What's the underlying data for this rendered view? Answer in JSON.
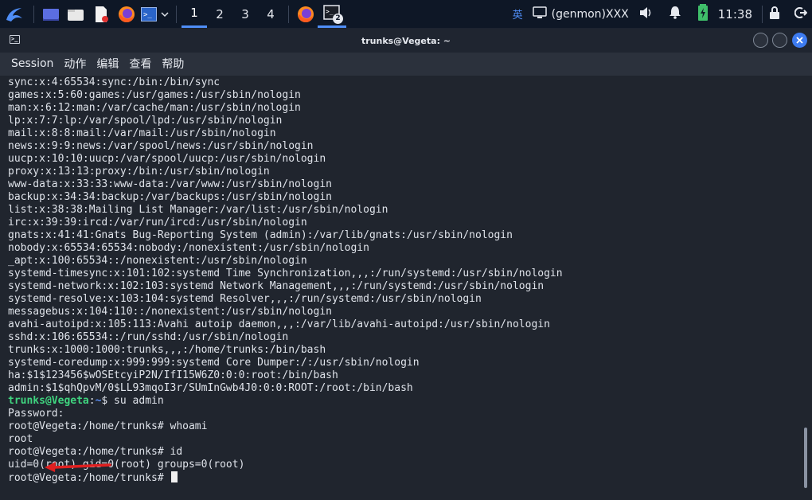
{
  "taskbar": {
    "workspaces": [
      "1",
      "2",
      "3",
      "4"
    ],
    "active_workspace": "1",
    "terminal_badge": "2",
    "ime": "英",
    "genmon": "(genmon)XXX",
    "clock": "11:38"
  },
  "window": {
    "title": "trunks@Vegeta: ~",
    "menu": [
      "Session",
      "动作",
      "编辑",
      "查看",
      "帮助"
    ]
  },
  "terminal": {
    "passwd_lines": [
      "sync:x:4:65534:sync:/bin:/bin/sync",
      "games:x:5:60:games:/usr/games:/usr/sbin/nologin",
      "man:x:6:12:man:/var/cache/man:/usr/sbin/nologin",
      "lp:x:7:7:lp:/var/spool/lpd:/usr/sbin/nologin",
      "mail:x:8:8:mail:/var/mail:/usr/sbin/nologin",
      "news:x:9:9:news:/var/spool/news:/usr/sbin/nologin",
      "uucp:x:10:10:uucp:/var/spool/uucp:/usr/sbin/nologin",
      "proxy:x:13:13:proxy:/bin:/usr/sbin/nologin",
      "www-data:x:33:33:www-data:/var/www:/usr/sbin/nologin",
      "backup:x:34:34:backup:/var/backups:/usr/sbin/nologin",
      "list:x:38:38:Mailing List Manager:/var/list:/usr/sbin/nologin",
      "irc:x:39:39:ircd:/var/run/ircd:/usr/sbin/nologin",
      "gnats:x:41:41:Gnats Bug-Reporting System (admin):/var/lib/gnats:/usr/sbin/nologin",
      "nobody:x:65534:65534:nobody:/nonexistent:/usr/sbin/nologin",
      "_apt:x:100:65534::/nonexistent:/usr/sbin/nologin",
      "systemd-timesync:x:101:102:systemd Time Synchronization,,,:/run/systemd:/usr/sbin/nologin",
      "systemd-network:x:102:103:systemd Network Management,,,:/run/systemd:/usr/sbin/nologin",
      "systemd-resolve:x:103:104:systemd Resolver,,,:/run/systemd:/usr/sbin/nologin",
      "messagebus:x:104:110::/nonexistent:/usr/sbin/nologin",
      "avahi-autoipd:x:105:113:Avahi autoip daemon,,,:/var/lib/avahi-autoipd:/usr/sbin/nologin",
      "sshd:x:106:65534::/run/sshd:/usr/sbin/nologin",
      "trunks:x:1000:1000:trunks,,,:/home/trunks:/bin/bash",
      "systemd-coredump:x:999:999:systemd Core Dumper:/:/usr/sbin/nologin",
      "ha:$1$123456$wOSEtcyiP2N/IfI15W6Z0:0:0:root:/bin/bash",
      "admin:$1$qhQpvM/0$LL93mqoI3r/SUmInGwb4J0:0:0:ROOT:/root:/bin/bash"
    ],
    "prompt_user": "trunks@Vegeta",
    "prompt_colon": ":",
    "prompt_path": "~",
    "prompt_cmd": "$ su admin",
    "password_line": "Password:",
    "root_prompt_1": "root@Vegeta:/home/trunks# whoami",
    "whoami_output": "root",
    "root_prompt_2": "root@Vegeta:/home/trunks# id",
    "id_output": "uid=0(root) gid=0(root) groups=0(root)",
    "root_prompt_3": "root@Vegeta:/home/trunks# "
  },
  "colors": {
    "prompt_user": "#3fd47f",
    "prompt_path": "#5a8ef5",
    "annotation_arrow": "#e02020",
    "close_button": "#3d7bf0"
  }
}
